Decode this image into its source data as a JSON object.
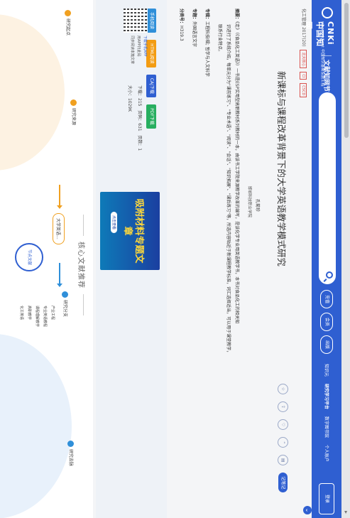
{
  "header": {
    "logo_main": "CNKi中国知网",
    "logo_sub": "www.cnki.net 中国知识基础设施工程",
    "section": "文献知网节",
    "search_placeholder": "",
    "btn_1": "充值",
    "btn_2": "会员",
    "btn_3": "出版",
    "links": [
      "知识元",
      "研究学习平台",
      "数字图书馆",
      "个人账户"
    ],
    "profile_label": "登录"
  },
  "meta": {
    "source": "化工管理",
    "year": "2017(20)",
    "tags": [
      "北大核心",
      "CI",
      "CSCD"
    ]
  },
  "article": {
    "title": "新课标与课程改革背景下的大学英语教学模式研究",
    "author": "孔菊珍",
    "institution": "邯郸科技职业学院",
    "abstract_label": "摘要：",
    "abstract_lines": [
      "《走》（《食品化工英语》）一书是ESP实用型高职教材系列教材的一本，由该书工学院来源教学改革的编写，是该化学专业用英语教学书，本书对食品化工的相关知",
      "识进行了系统介绍，每单元分为\"课前练习\"、\"专业术语\"、\"阅读\"、\"会话\"、\"知识拓展\"、\"课后练习\"等，所选内容贴近于新课程教学标准，词汇选择适当，可以用于课堂教学，",
      "联系行业特点。"
    ],
    "topic_label": "专辑：",
    "topic_value": "工程科技Ⅰ辑; 哲学与人文科学",
    "subject_label": "专题：",
    "subject_value": "外国语言文字",
    "class_label": "分类号：",
    "class_value": "H319.3",
    "tools": [
      "收藏",
      "分享",
      "关注",
      "引用",
      "打印"
    ],
    "note_button": "记笔记"
  },
  "download": {
    "buttons": [
      {
        "label": "手机阅读",
        "color": "#2f8fd9"
      },
      {
        "label": "HTML阅读",
        "color": "#f39c12"
      },
      {
        "label": "CAJ下载",
        "color": "#2f5fd1"
      },
      {
        "label": "PDF下载",
        "color": "#27ae60"
      }
    ],
    "app_title": "下载手机APP",
    "app_line1": "用APP扫此码",
    "app_line2": "同步阅读本篇文章",
    "downloads_label": "下载：",
    "downloads": "215",
    "pages_label": "页码：",
    "pages": "631",
    "pagecount_label": "页数：",
    "pagecount": "1",
    "size_label": "大小：",
    "size": "1029K",
    "banner_text": "吸附材料专题文章",
    "banner_sub": "点击查看"
  },
  "recommend": {
    "title": "核心文献推荐",
    "nodes": [
      {
        "label": "研究起点",
        "color": "#f0a020"
      },
      {
        "label": "研究来源",
        "color": "#f0a020"
      },
      {
        "label": "大学英语...",
        "color": "#f0a020"
      },
      {
        "label": "节点文献",
        "color": "#2f5fd1"
      },
      {
        "label": "研究分支",
        "color": "#2f8fd9"
      },
      {
        "label": "研究去脉",
        "color": "#2f8fd9"
      }
    ],
    "branch_items": [
      "产业工程",
      "专业英语教程",
      "课程理解教学",
      "高职教学",
      "化工英语"
    ]
  },
  "colors": {
    "brand": "#2f5fd1",
    "accent": "#f0a020",
    "tag": "#d9534f"
  }
}
